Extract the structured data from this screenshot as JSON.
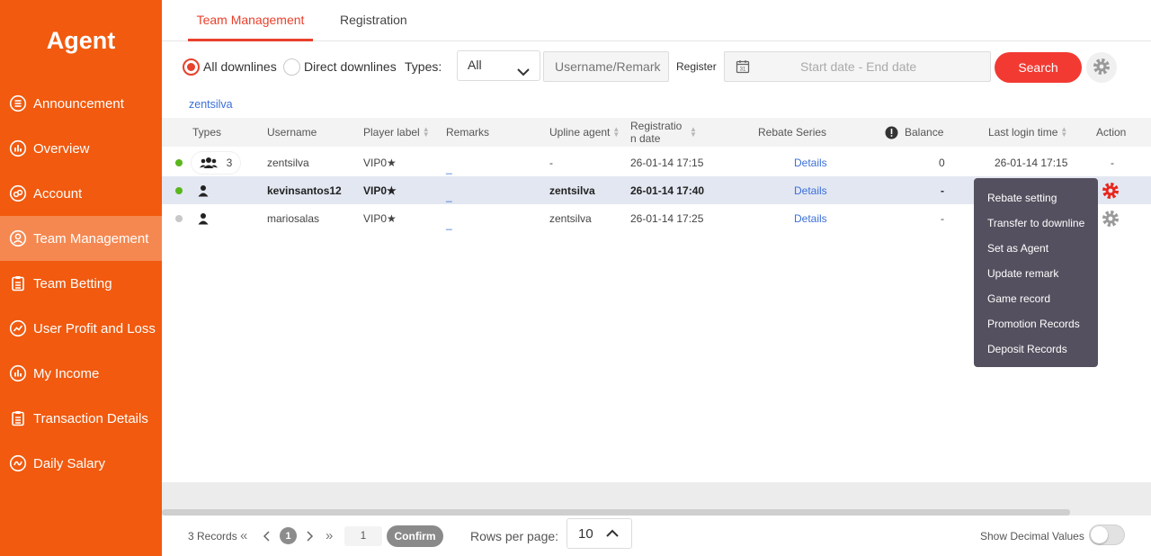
{
  "sidebar": {
    "title": "Agent",
    "items": [
      {
        "label": "Announcement",
        "icon": "list-icon"
      },
      {
        "label": "Overview",
        "icon": "chart-icon"
      },
      {
        "label": "Account",
        "icon": "link-icon"
      },
      {
        "label": "Team Management",
        "icon": "user-icon",
        "active": true
      },
      {
        "label": "Team Betting",
        "icon": "clipboard-icon"
      },
      {
        "label": "User Profit and Loss",
        "icon": "trend-icon"
      },
      {
        "label": "My Income",
        "icon": "chart-icon"
      },
      {
        "label": "Transaction Details",
        "icon": "clipboard-icon"
      },
      {
        "label": "Daily Salary",
        "icon": "income-icon"
      }
    ]
  },
  "tabs": [
    "Team Management",
    "Registration"
  ],
  "filters": {
    "all_downlines": "All downlines",
    "direct_downlines": "Direct downlines",
    "types_label": "Types:",
    "types_value": "All",
    "username_placeholder": "Username/Remark",
    "register_label": "Register",
    "date_placeholder": "Start date - End date",
    "search_label": "Search"
  },
  "breadcrumb": "zentsilva",
  "table": {
    "headers": {
      "types": "Types",
      "username": "Username",
      "player_label": "Player label",
      "remarks": "Remarks",
      "upline_agent": "Upline agent",
      "registration_date": "Registratio n date",
      "rebate_series": "Rebate Series",
      "balance": "Balance",
      "last_login": "Last login time",
      "action": "Action"
    },
    "rows": [
      {
        "status_color": "#5ab61d",
        "type_count": "3",
        "username": "zentsilva",
        "label": "VIP0★",
        "remark": "_",
        "upline": "-",
        "reg_date": "26-01-14 17:15",
        "rebate": "Details",
        "balance": "0",
        "last_login": "26-01-14 17:15",
        "action": "-"
      },
      {
        "status_color": "#5ab61d",
        "type_count": "",
        "username": "kevinsantos12",
        "label": "VIP0★",
        "remark": "_",
        "upline": "zentsilva",
        "reg_date": "26-01-14 17:40",
        "rebate": "Details",
        "balance": "-",
        "last_login": "",
        "action": ""
      },
      {
        "status_color": "#c8c8c8",
        "type_count": "",
        "username": "mariosalas",
        "label": "VIP0★",
        "remark": "_",
        "upline": "zentsilva",
        "reg_date": "26-01-14 17:25",
        "rebate": "Details",
        "balance": "-",
        "last_login": "",
        "action": ""
      }
    ]
  },
  "action_menu": [
    "Rebate setting",
    "Transfer to downline",
    "Set as Agent",
    "Update remark",
    "Game record",
    "Promotion Records",
    "Deposit Records"
  ],
  "footer": {
    "records": "3 Records",
    "current_page": "1",
    "page_input": "1",
    "confirm": "Confirm",
    "rows_per_page_label": "Rows per page:",
    "rows_per_page_value": "10",
    "show_decimal": "Show Decimal Values"
  },
  "colors": {
    "brand": "#f15a0f",
    "accent": "#e8412c",
    "search": "#f23a33",
    "link": "#3b6fd8",
    "menu_bg": "#55505f"
  }
}
